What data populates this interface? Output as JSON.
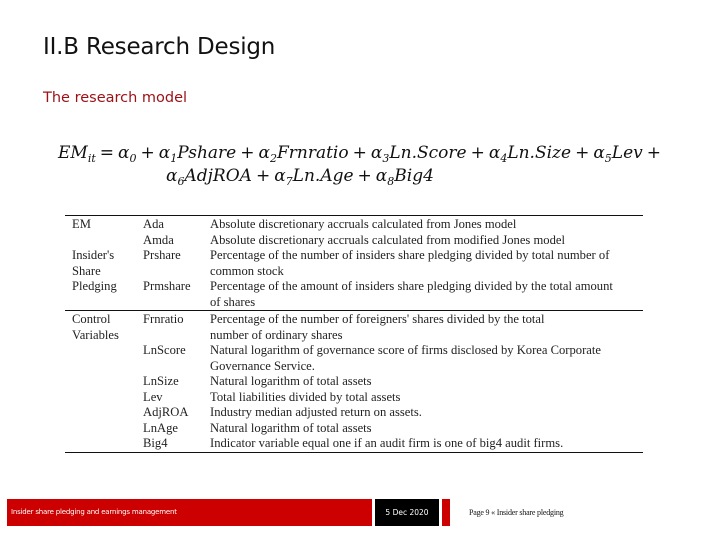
{
  "slide": {
    "title": "II.B Research Design",
    "subtitle": "The research model"
  },
  "equation": {
    "line1": [
      {
        "base": "EM",
        "sub": "it"
      },
      {
        "op": "="
      },
      {
        "base": "α",
        "sub": "0"
      },
      {
        "op": "+"
      },
      {
        "base": "α",
        "sub": "1",
        "term": "Pshare"
      },
      {
        "op": "+"
      },
      {
        "base": "α",
        "sub": "2",
        "term": "Frnratio"
      },
      {
        "op": "+"
      },
      {
        "base": "α",
        "sub": "3",
        "term": "Ln.Score"
      },
      {
        "op": "+"
      },
      {
        "base": "α",
        "sub": "4",
        "term": "Ln.Size"
      },
      {
        "op": "+"
      },
      {
        "base": "α",
        "sub": "5",
        "term": "Lev"
      },
      {
        "op": "+"
      }
    ],
    "line2": [
      {
        "base": "α",
        "sub": "6",
        "term": "AdjROA"
      },
      {
        "op": "+"
      },
      {
        "base": "α",
        "sub": "7",
        "term": "Ln.Age"
      },
      {
        "op": "+"
      },
      {
        "base": "α",
        "sub": "8",
        "term": "Big4"
      }
    ]
  },
  "variables_table": {
    "groups": [
      {
        "rows": [
          {
            "category": "EM",
            "variable": "Ada",
            "description": "Absolute discretionary accruals calculated from Jones model"
          },
          {
            "category": "",
            "variable": "Amda",
            "description": "Absolute discretionary accruals calculated from modified Jones model"
          },
          {
            "category": "Insider's",
            "variable": "Prshare",
            "description": "Percentage of the number of insiders share pledging divided by total number of"
          },
          {
            "category": "Share",
            "variable": "",
            "description": "common stock"
          },
          {
            "category": "Pledging",
            "variable": "Prmshare",
            "description": "Percentage of the amount of insiders share pledging divided by the total amount"
          },
          {
            "category": "",
            "variable": "",
            "description": "of shares"
          }
        ]
      },
      {
        "rows": [
          {
            "category": "Control",
            "variable": "Frnratio",
            "description": "Percentage of the number of foreigners' shares divided by the total"
          },
          {
            "category": "Variables",
            "variable": "",
            "description": "number of ordinary shares"
          },
          {
            "category": "",
            "variable": "LnScore",
            "description": "Natural logarithm of governance score of firms disclosed by Korea Corporate"
          },
          {
            "category": "",
            "variable": "",
            "description": "Governance Service."
          },
          {
            "category": "",
            "variable": "LnSize",
            "description": "Natural logarithm of total assets"
          },
          {
            "category": "",
            "variable": "Lev",
            "description": "Total liabilities divided by total assets"
          },
          {
            "category": "",
            "variable": "AdjROA",
            "description": "Industry median adjusted return on assets."
          },
          {
            "category": "",
            "variable": "LnAge",
            "description": "Natural logarithm of total assets"
          },
          {
            "category": "",
            "variable": "Big4",
            "description": "Indicator variable equal one if an audit firm is one of big4 audit firms."
          }
        ]
      }
    ]
  },
  "footer": {
    "presentation_title": "Insider share pledging and earnings management",
    "date": "5 Dec 2020",
    "page_info": "Page 9 « Insider share pledging"
  },
  "colors": {
    "accent_red": "#cc0000",
    "subtitle_red": "#9b1116",
    "date_box": "#000000"
  }
}
